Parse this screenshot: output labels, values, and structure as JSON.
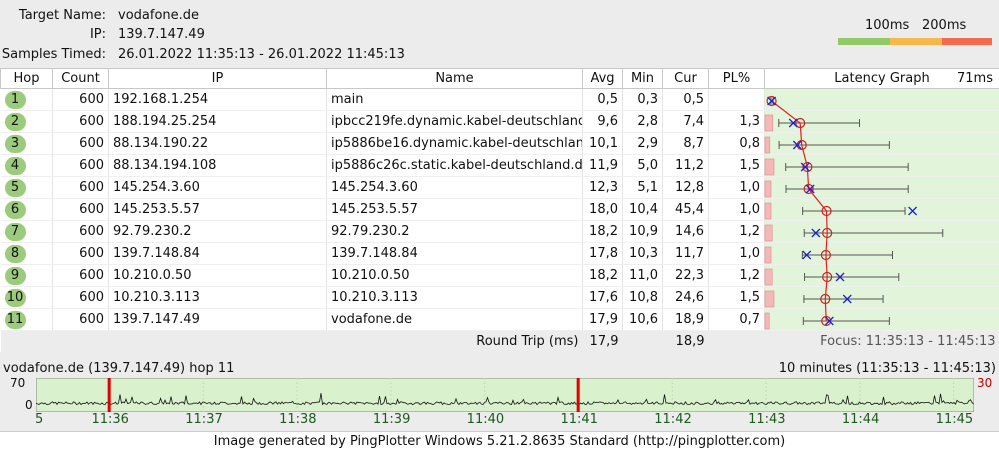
{
  "header": {
    "target_label": "Target Name:",
    "target_value": "vodafone.de",
    "ip_label": "IP:",
    "ip_value": "139.7.147.49",
    "samples_label": "Samples Timed:",
    "samples_value": "26.01.2022 11:35:13 - 26.01.2022 11:45:13",
    "legend_100": "100ms",
    "legend_200": "200ms",
    "legend_colors": [
      "#90c965",
      "#f7b84b",
      "#f36a4f"
    ]
  },
  "columns": {
    "hop": "Hop",
    "count": "Count",
    "ip": "IP",
    "name": "Name",
    "avg": "Avg",
    "min": "Min",
    "cur": "Cur",
    "pl": "PL%",
    "graph": "Latency Graph",
    "graph_max": "71ms"
  },
  "rows": [
    {
      "hop": "1",
      "count": "600",
      "ip": "192.168.1.254",
      "name": "main",
      "avg": "0,5",
      "min": "0,3",
      "cur": "0,5",
      "pl": ""
    },
    {
      "hop": "2",
      "count": "600",
      "ip": "188.194.25.254",
      "name": "ipbcc219fe.dynamic.kabel-deutschland.",
      "avg": "9,6",
      "min": "2,8",
      "cur": "7,4",
      "pl": "1,3"
    },
    {
      "hop": "3",
      "count": "600",
      "ip": "88.134.190.22",
      "name": "ip5886be16.dynamic.kabel-deutschland",
      "avg": "10,1",
      "min": "2,9",
      "cur": "8,7",
      "pl": "0,8"
    },
    {
      "hop": "4",
      "count": "600",
      "ip": "88.134.194.108",
      "name": "ip5886c26c.static.kabel-deutschland.de",
      "avg": "11,9",
      "min": "5,0",
      "cur": "11,2",
      "pl": "1,5"
    },
    {
      "hop": "5",
      "count": "600",
      "ip": "145.254.3.60",
      "name": "145.254.3.60",
      "avg": "12,3",
      "min": "5,1",
      "cur": "12,8",
      "pl": "1,0"
    },
    {
      "hop": "6",
      "count": "600",
      "ip": "145.253.5.57",
      "name": "145.253.5.57",
      "avg": "18,0",
      "min": "10,4",
      "cur": "45,4",
      "pl": "1,0"
    },
    {
      "hop": "7",
      "count": "600",
      "ip": "92.79.230.2",
      "name": "92.79.230.2",
      "avg": "18,2",
      "min": "10,9",
      "cur": "14,6",
      "pl": "1,2"
    },
    {
      "hop": "8",
      "count": "600",
      "ip": "139.7.148.84",
      "name": "139.7.148.84",
      "avg": "17,8",
      "min": "10,3",
      "cur": "11,7",
      "pl": "1,0"
    },
    {
      "hop": "9",
      "count": "600",
      "ip": "10.210.0.50",
      "name": "10.210.0.50",
      "avg": "18,2",
      "min": "11,0",
      "cur": "22,3",
      "pl": "1,2"
    },
    {
      "hop": "10",
      "count": "600",
      "ip": "10.210.3.113",
      "name": "10.210.3.113",
      "avg": "17,6",
      "min": "10,8",
      "cur": "24,6",
      "pl": "1,5"
    },
    {
      "hop": "11",
      "count": "600",
      "ip": "139.7.147.49",
      "name": "vodafone.de",
      "avg": "17,9",
      "min": "10,6",
      "cur": "18,9",
      "pl": "0,7"
    }
  ],
  "latency_graph": {
    "scale_max_ms": 71,
    "max_ms": [
      1.0,
      28.5,
      38.0,
      44.0,
      44.0,
      43.0,
      55.0,
      39.0,
      41.0,
      36.0,
      38.0
    ]
  },
  "round_trip": {
    "label": "Round Trip (ms)",
    "avg": "17,9",
    "cur": "18,9",
    "focus": "Focus: 11:35:13 - 11:45:13"
  },
  "timeline": {
    "title": "vodafone.de (139.7.147.49) hop 11",
    "range": "10 minutes (11:35:13 - 11:45:13)",
    "y_top": "70",
    "y_zero": "0",
    "y_right": "30",
    "tick_first": "5",
    "ticks": [
      "11:36",
      "11:37",
      "11:38",
      "11:39",
      "11:40",
      "11:41",
      "11:42",
      "11:43",
      "11:44",
      "11:45"
    ],
    "loss_marks_min": [
      0.78,
      5.78
    ]
  },
  "footer": "Image generated by PingPlotter Windows 5.21.2.8635 Standard (http://pingplotter.com)"
}
